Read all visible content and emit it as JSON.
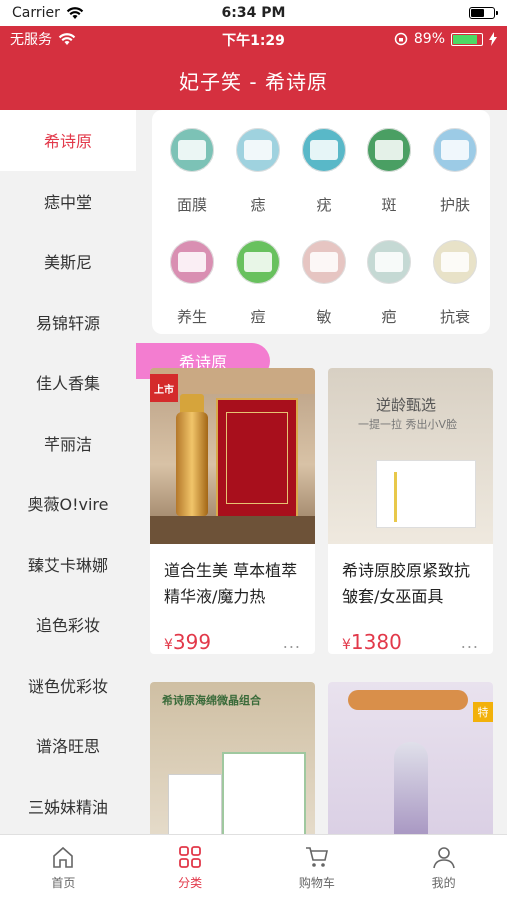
{
  "ios_status": {
    "carrier": "Carrier",
    "time": "6:34 PM"
  },
  "android_status": {
    "network": "无服务",
    "time": "下午1:29",
    "battery": "89%"
  },
  "header": {
    "title": "妃子笑 - 希诗原",
    "bg_color": "#d5303f"
  },
  "sidebar": {
    "items": [
      {
        "label": "希诗原"
      },
      {
        "label": "痣中堂"
      },
      {
        "label": "美斯尼"
      },
      {
        "label": "易锦轩源"
      },
      {
        "label": "佳人香集"
      },
      {
        "label": "芊丽洁"
      },
      {
        "label": "奥薇O!vire"
      },
      {
        "label": "臻艾卡琳娜"
      },
      {
        "label": "追色彩妆"
      },
      {
        "label": "谜色优彩妆"
      },
      {
        "label": "谱洛旺思"
      },
      {
        "label": "三姊妹精油"
      }
    ],
    "active_color": "#e2394a"
  },
  "categories": {
    "items": [
      {
        "label": "面膜",
        "color": "#7cc2b6"
      },
      {
        "label": "痣",
        "color": "#9fd2df"
      },
      {
        "label": "疣",
        "color": "#59b8c8"
      },
      {
        "label": "斑",
        "color": "#4a9f63"
      },
      {
        "label": "护肤",
        "color": "#9ccbe6"
      },
      {
        "label": "养生",
        "color": "#d98fb2"
      },
      {
        "label": "痘",
        "color": "#68c15e"
      },
      {
        "label": "敏",
        "color": "#e6c5c2"
      },
      {
        "label": "疤",
        "color": "#c5d9d4"
      },
      {
        "label": "抗衰",
        "color": "#e8e2c8"
      }
    ]
  },
  "section": {
    "title": "希诗原",
    "color": "#f37dd0"
  },
  "products": [
    {
      "name": "道合生美 草本植萃精华液/魔力热",
      "currency": "¥",
      "price": "399",
      "art": {
        "new_tag": "上市"
      }
    },
    {
      "name": "希诗原胶原紧致抗皱套/女巫面具",
      "currency": "¥",
      "price": "1380",
      "art": {
        "headline": "逆龄甄选",
        "sub": "一提一拉 秀出小V脸"
      }
    },
    {
      "name": "",
      "currency": "",
      "price": "",
      "art": {
        "headline": "希诗原海绵微晶组合"
      }
    },
    {
      "name": "",
      "currency": "",
      "price": "",
      "art": {
        "badge": "特"
      }
    }
  ],
  "more_label": "...",
  "tabbar": {
    "items": [
      {
        "label": "首页",
        "icon": "home-icon"
      },
      {
        "label": "分类",
        "icon": "grid-icon"
      },
      {
        "label": "购物车",
        "icon": "cart-icon"
      },
      {
        "label": "我的",
        "icon": "user-icon"
      }
    ],
    "active_index": 1
  }
}
